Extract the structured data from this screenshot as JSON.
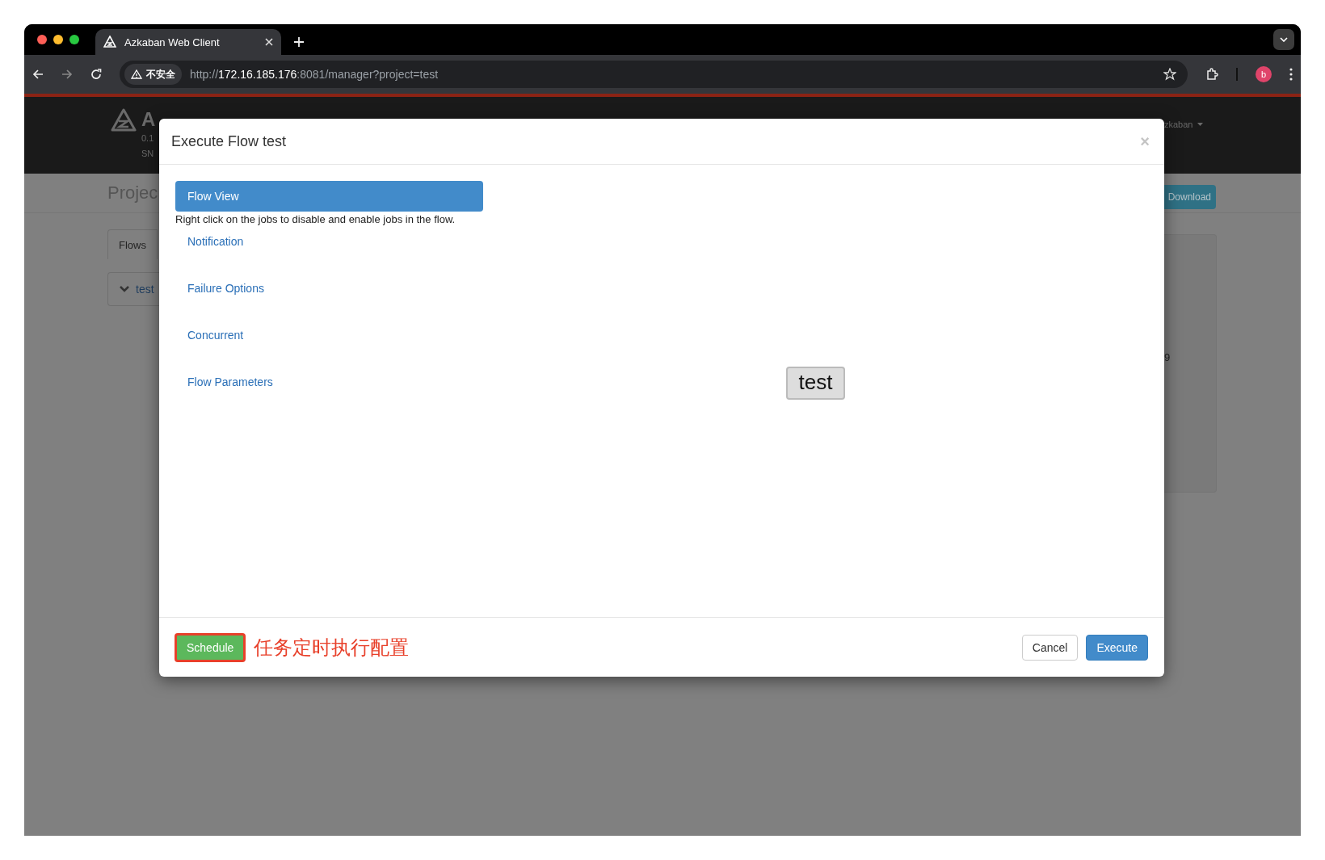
{
  "browser": {
    "tab_title": "Azkaban Web Client",
    "security_label": "不安全",
    "url": {
      "scheme": "http://",
      "host": "172.16.185.176",
      "rest": ":8081/manager?project=test"
    },
    "profile_initial": "b"
  },
  "background": {
    "logo_letter": "A",
    "version_line_1": "0.1",
    "version_line_2": "SN",
    "user_menu": "zkaban",
    "page_title": "Projec",
    "download_button": "Download",
    "tabs": [
      {
        "label": "Flows"
      }
    ],
    "flows": [
      {
        "label": "test"
      }
    ],
    "panel_text": "9"
  },
  "modal": {
    "title": "Execute Flow test",
    "close": "×",
    "nav": [
      {
        "label": "Flow View",
        "selected": true,
        "hint": "Right click on the jobs to disable and enable jobs in the flow."
      },
      {
        "label": "Notification",
        "selected": false
      },
      {
        "label": "Failure Options",
        "selected": false
      },
      {
        "label": "Concurrent",
        "selected": false
      },
      {
        "label": "Flow Parameters",
        "selected": false
      }
    ],
    "graph_node": "test",
    "schedule_button": "Schedule",
    "annotation": "任务定时执行配置",
    "cancel_button": "Cancel",
    "execute_button": "Execute"
  }
}
